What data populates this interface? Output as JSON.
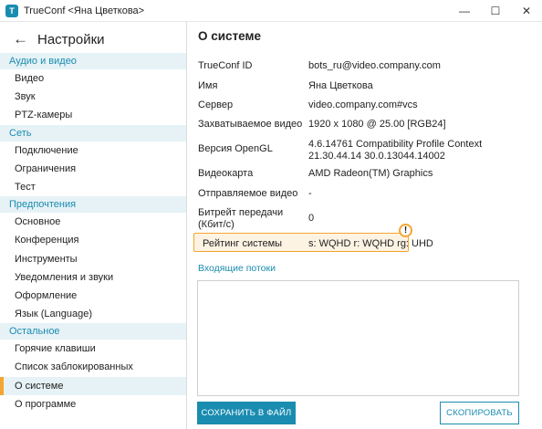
{
  "window": {
    "title": "TrueConf <Яна Цветкова>",
    "app_icon": "trueconf-logo-icon",
    "controls": {
      "minimize": "—",
      "maximize": "☐",
      "close": "✕"
    }
  },
  "sidebar": {
    "back_icon": "←",
    "title": "Настройки",
    "sections": [
      {
        "label": "Аудио и видео",
        "items": [
          "Видео",
          "Звук",
          "PTZ-камеры"
        ]
      },
      {
        "label": "Сеть",
        "items": [
          "Подключение",
          "Ограничения",
          "Тест"
        ]
      },
      {
        "label": "Предпочтения",
        "items": [
          "Основное",
          "Конференция",
          "Инструменты",
          "Уведомления и звуки",
          "Оформление",
          "Язык (Language)"
        ]
      },
      {
        "label": "Остальное",
        "items": [
          "Горячие клавиши",
          "Список заблокированных",
          "О системе",
          "О программе"
        ]
      }
    ],
    "active_item": "О системе"
  },
  "main": {
    "title": "О системе",
    "rows": [
      {
        "label": "TrueConf ID",
        "value": "bots_ru@video.company.com"
      },
      {
        "label": "Имя",
        "value": "Яна Цветкова"
      },
      {
        "label": "Сервер",
        "value": "video.company.com#vcs"
      },
      {
        "label": "Захватываемое видео",
        "value": "1920 x 1080 @ 25.00 [RGB24]"
      },
      {
        "label": "Версия OpenGL",
        "value": "4.6.14761 Compatibility Profile Context 21.30.44.14 30.0.13044.14002"
      },
      {
        "label": "Видеокарта",
        "value": "AMD Radeon(TM) Graphics"
      },
      {
        "label": "Отправляемое видео",
        "value": "-"
      },
      {
        "label": "Битрейт передачи (Кбит/с)",
        "value": "0"
      },
      {
        "label": "Рейтинг системы",
        "value": "s: WQHD r: WQHD rg: UHD"
      }
    ],
    "warning_icon": "!",
    "incoming_streams_label": "Входящие потоки",
    "save_button": "СОХРАНИТЬ В ФАЙЛ",
    "copy_button": "СКОПИРОВАТЬ"
  },
  "colors": {
    "accent": "#1a8cb0",
    "highlight": "#f5a531",
    "section_bg": "#e6f2f6"
  }
}
